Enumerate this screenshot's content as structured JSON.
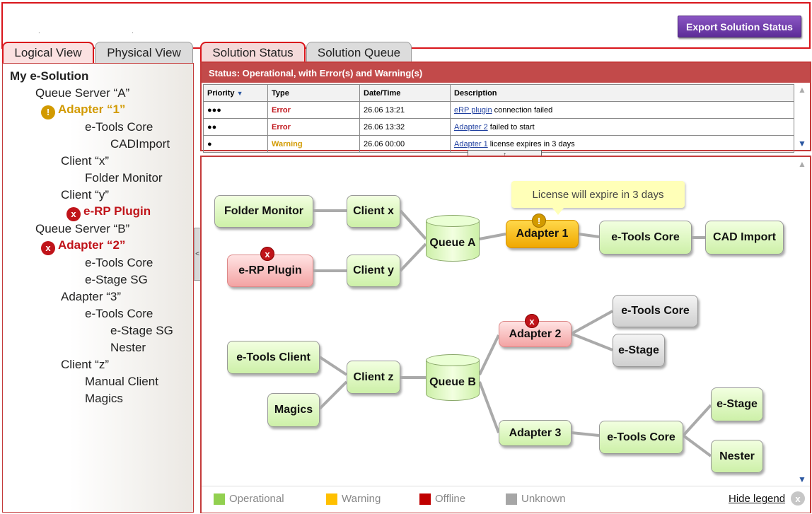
{
  "toolbar": {
    "export_label": "Export Solution Status"
  },
  "tabs_left": [
    {
      "label": "Logical View",
      "active": true
    },
    {
      "label": "Physical View",
      "active": false
    }
  ],
  "tabs_right": [
    {
      "label": "Solution Status",
      "active": true
    },
    {
      "label": "Solution Queue",
      "active": false
    }
  ],
  "tree": {
    "root": "My e-Solution",
    "items": [
      "Queue Server “A”",
      "Adapter “1”",
      "e-Tools Core",
      "CADImport",
      "Client “x”",
      "Folder Monitor",
      "Client “y”",
      "e-RP Plugin",
      "Queue Server “B”",
      "Adapter “2”",
      "e-Tools Core",
      "e-Stage SG",
      "Adapter “3”",
      "e-Tools Core",
      "e-Stage SG",
      "Nester",
      "Client “z”",
      "Manual Client",
      "Magics"
    ],
    "collapse_glyph": "<"
  },
  "status": {
    "header": "Status: Operational, with Error(s) and Warning(s)",
    "columns": [
      "Priority",
      "Type",
      "Date/Time",
      "Description"
    ],
    "rows": [
      {
        "priority": "●●●",
        "type": "Error",
        "datetime": "26.06 13:21",
        "link": "eRP plugin",
        "text": " connection failed"
      },
      {
        "priority": "●●",
        "type": "Error",
        "datetime": "26.06 13:32",
        "link": "Adapter 2",
        "text": " failed to start"
      },
      {
        "priority": "●",
        "type": "Warning",
        "datetime": "26.06 00:00",
        "link": "Adapter 1",
        "text": " license expires in 3 days"
      }
    ]
  },
  "diagram": {
    "tooltip": "License will expire in 3 days",
    "nodes": {
      "folder_monitor": "Folder Monitor",
      "client_x": "Client x",
      "erp_plugin": "e-RP Plugin",
      "client_y": "Client y",
      "queue_a": "Queue A",
      "adapter_1": "Adapter 1",
      "etools_core_1": "e-Tools Core",
      "cad_import": "CAD Import",
      "etools_client": "e-Tools Client",
      "magics": "Magics",
      "client_z": "Client z",
      "queue_b": "Queue B",
      "adapter_2": "Adapter 2",
      "etools_core_2": "e-Tools Core",
      "estage_2": "e-Stage",
      "adapter_3": "Adapter 3",
      "etools_core_3": "e-Tools Core",
      "estage_3": "e-Stage",
      "nester": "Nester"
    }
  },
  "legend": {
    "items": [
      {
        "label": "Operational",
        "color": "#92d050"
      },
      {
        "label": "Warning",
        "color": "#ffc000"
      },
      {
        "label": "Offline",
        "color": "#c00000"
      },
      {
        "label": "Unknown",
        "color": "#a6a6a6"
      }
    ],
    "hide_label": "Hide legend"
  },
  "colors": {
    "accent": "#d9151b",
    "header": "#c24a4a",
    "export": "#6a35a8"
  }
}
